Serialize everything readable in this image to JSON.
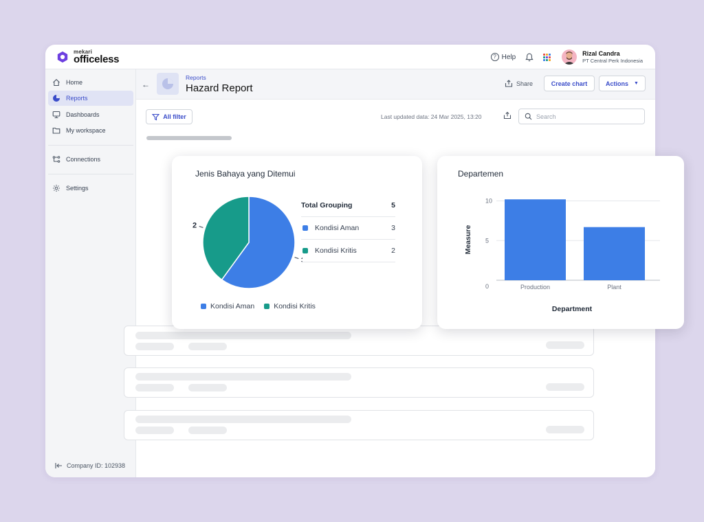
{
  "app": {
    "logo_small": "mekari",
    "logo_big": "officeless"
  },
  "topbar": {
    "help_label": "Help",
    "user_name": "Rizal Candra",
    "user_company": "PT Central Perk Indonesia"
  },
  "sidebar": {
    "items": [
      {
        "label": "Home",
        "icon": "home-icon"
      },
      {
        "label": "Reports",
        "icon": "pie-chart-icon"
      },
      {
        "label": "Dashboards",
        "icon": "monitor-icon"
      },
      {
        "label": "My workspace",
        "icon": "folder-icon"
      },
      {
        "label": "Connections",
        "icon": "connections-icon"
      },
      {
        "label": "Settings",
        "icon": "gear-icon"
      }
    ],
    "active": "Reports",
    "company_id": "Company ID: 102938"
  },
  "header": {
    "breadcrumb": "Reports",
    "title": "Hazard Report",
    "share_label": "Share",
    "create_chart_label": "Create chart",
    "actions_label": "Actions"
  },
  "toolbar": {
    "filter_label": "All filter",
    "last_updated": "Last updated data: 24 Mar 2025, 13:20",
    "search_placeholder": "Search"
  },
  "colors": {
    "accent": "#3a4cc9",
    "blue": "#3d7ee6",
    "teal": "#179b8a"
  },
  "pie_card": {
    "title": "Jenis Bahaya yang Ditemui",
    "total_label": "Total Grouping",
    "total_value": "5",
    "legend": [
      {
        "label": "Kondisi Aman",
        "value": "3"
      },
      {
        "label": "Kondisi Kritis",
        "value": "2"
      }
    ]
  },
  "bar_card": {
    "title": "Departemen"
  },
  "chart_data": [
    {
      "type": "pie",
      "title": "Jenis Bahaya yang Ditemui",
      "categories": [
        "Kondisi Aman",
        "Kondisi Kritis"
      ],
      "values": [
        3,
        2
      ],
      "colors": [
        "#3d7ee6",
        "#179b8a"
      ],
      "legend": "bottom"
    },
    {
      "type": "bar",
      "title": "Departemen",
      "categories": [
        "Production",
        "Plant"
      ],
      "values": [
        10.2,
        6.7
      ],
      "xlabel": "Department",
      "ylabel": "Measure",
      "yticks": [
        "0",
        "5",
        "10"
      ],
      "ylim": [
        0,
        11
      ],
      "grid": true,
      "color": "#3d7ee6"
    }
  ]
}
